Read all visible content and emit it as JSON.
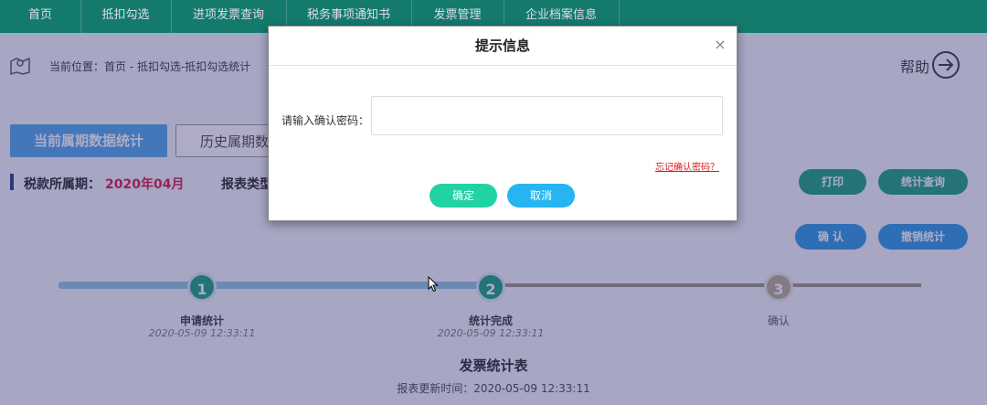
{
  "nav": {
    "items": [
      "首页",
      "抵扣勾选",
      "进项发票查询",
      "税务事项通知书",
      "发票管理",
      "企业档案信息"
    ],
    "color": "#0b8a6a"
  },
  "breadcrumb": {
    "text": "当前位置：首页 - 抵扣勾选-抵扣勾选统计"
  },
  "help": {
    "label": "帮助"
  },
  "tabs": {
    "current": "当前属期数据统计",
    "history": "历史属期数"
  },
  "period": {
    "label": "税款所属期：",
    "value": "2020年04月",
    "report_type_label": "报表类型"
  },
  "actions": {
    "print": "打印",
    "stat_query": "统计查询",
    "confirm": "确 认",
    "cancel_stat": "撤销统计"
  },
  "steps": [
    {
      "number": "1",
      "label": "申请统计",
      "time": "2020-05-09 12:33:11",
      "state": "done"
    },
    {
      "number": "2",
      "label": "统计完成",
      "time": "2020-05-09 12:33:11",
      "state": "done"
    },
    {
      "number": "3",
      "label": "确认",
      "time": "",
      "state": "pending"
    }
  ],
  "report": {
    "title": "发票统计表",
    "updated": "报表更新时间：2020-05-09 12:33:11"
  },
  "dialog": {
    "title": "提示信息",
    "close_icon": "close-icon",
    "password_label": "请输入确认密码：",
    "password_value": "",
    "forgot_link": "忘记确认密码？",
    "ok": "确定",
    "cancel": "取消"
  }
}
